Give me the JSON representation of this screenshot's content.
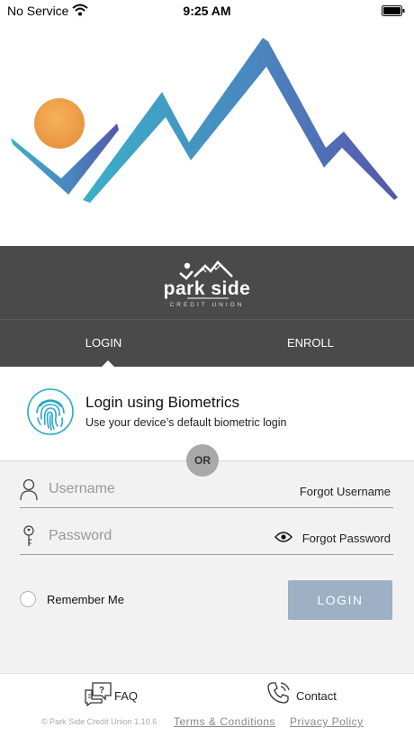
{
  "status_bar": {
    "carrier": "No Service",
    "time": "9:25 AM",
    "wifi_icon": "wifi-icon",
    "battery_icon": "battery-icon"
  },
  "hero": {
    "sun_color": "#f0a04b",
    "mountain_colors": [
      "#3aa7c8",
      "#5a5fb0"
    ]
  },
  "brand": {
    "name": "park side",
    "sub": "CREDIT UNION",
    "band_color": "#4a4a4a"
  },
  "tabs": [
    {
      "label": "LOGIN",
      "active": true
    },
    {
      "label": "ENROLL",
      "active": false
    }
  ],
  "biometrics": {
    "title": "Login using Biometrics",
    "subtitle": "Use your device’s default biometric login",
    "icon": "fingerprint-icon",
    "icon_color": "#2aa6c8"
  },
  "divider": {
    "label": "OR"
  },
  "form": {
    "username": {
      "placeholder": "Username",
      "value": "",
      "forgot_label": "Forgot Username",
      "icon": "user-icon"
    },
    "password": {
      "placeholder": "Password",
      "value": "",
      "forgot_label": "Forgot Password",
      "icon": "key-icon",
      "toggle_icon": "eye-icon"
    },
    "remember_label": "Remember Me",
    "login_label": "LOGIN",
    "login_color": "#9db0c4"
  },
  "footer": {
    "faq_label": "FAQ",
    "faq_icon": "faq-chat-icon",
    "contact_label": "Contact",
    "contact_icon": "phone-icon",
    "copyright": "© Park Side Credit Union 1.10.6",
    "terms_label": "Terms & Conditions",
    "privacy_label": "Privacy Policy"
  }
}
